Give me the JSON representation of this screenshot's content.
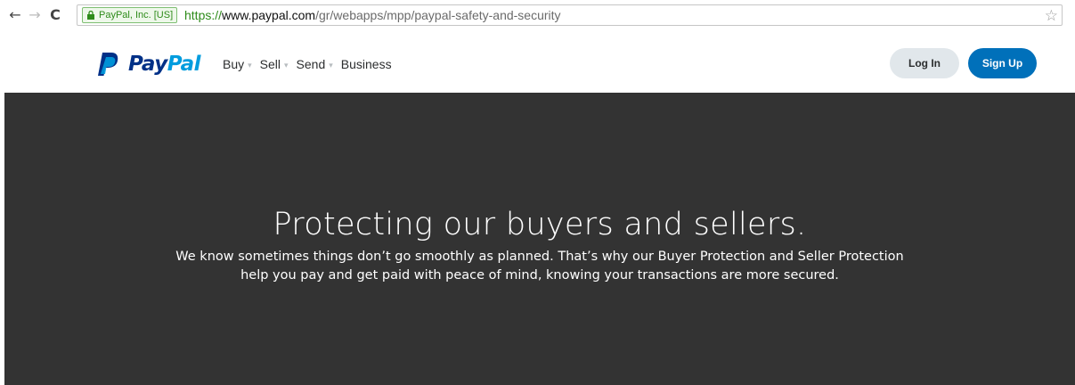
{
  "browser": {
    "ev_label": "PayPal, Inc. [US]",
    "url_scheme": "https://",
    "url_host": "www.paypal.com",
    "url_path": "/gr/webapps/mpp/paypal-safety-and-security",
    "back_glyph": "←",
    "forward_glyph": "→",
    "reload_glyph": "C",
    "star_glyph": "☆"
  },
  "header": {
    "logo_pay": "Pay",
    "logo_pal": "Pal",
    "nav": [
      {
        "label": "Buy",
        "caret": "▾"
      },
      {
        "label": "Sell",
        "caret": "▾"
      },
      {
        "label": "Send",
        "caret": "▾"
      },
      {
        "label": "Business",
        "caret": ""
      }
    ],
    "login_label": "Log In",
    "signup_label": "Sign Up"
  },
  "hero": {
    "title": "Protecting our buyers and sellers.",
    "line1": "We know sometimes things don’t go smoothly as planned. That’s why our Buyer Protection and Seller Protection",
    "line2": "help you pay and get paid with peace of mind, knowing your transactions are more secured."
  },
  "colors": {
    "brand_dark": "#003087",
    "brand_light": "#009cde",
    "signup_bg": "#0070ba",
    "hero_bg": "#333333"
  }
}
